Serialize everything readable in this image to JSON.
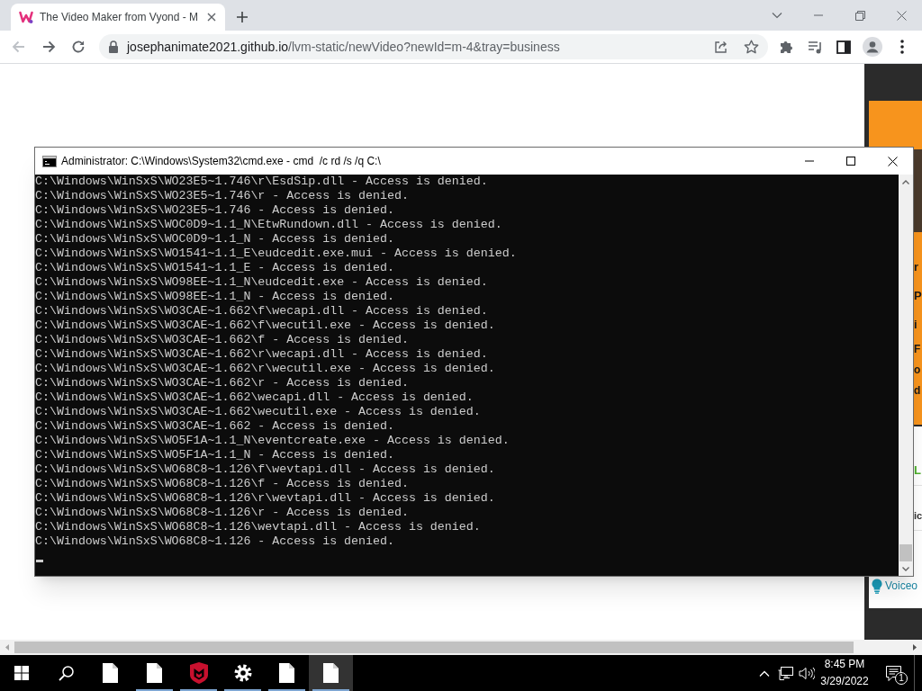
{
  "browser": {
    "tabs": [
      {
        "title": "The Video Maker from Vyond - M",
        "selected": true
      }
    ],
    "nav_buttons": [
      {
        "kind": "back",
        "disabled": true
      },
      {
        "kind": "forward",
        "disabled": false
      },
      {
        "kind": "reload",
        "disabled": false
      }
    ],
    "address": {
      "host": "josephanimate2021.github.io",
      "path": "/lvm-static/newVideo?newId=m-4&tray=business"
    }
  },
  "page": {
    "banner_lines": [
      {
        "text": "r",
        "kind": "heading"
      },
      {
        "text": "P",
        "kind": "heading"
      },
      {
        "text": "i",
        "kind": "heading"
      },
      {
        "text": "F",
        "kind": "body"
      },
      {
        "text": "o",
        "kind": "body"
      },
      {
        "text": "d",
        "kind": "body"
      }
    ],
    "panel_lines": [
      {
        "text": "L",
        "kind": "heading"
      },
      {
        "text": "ic",
        "kind": "label"
      }
    ],
    "tip": "Voiceo"
  },
  "console_window": {
    "title": "Administrator: C:\\Windows\\System32\\cmd.exe - cmd  /c rd /s /q C:\\",
    "lines": [
      "C:\\Windows\\WinSxS\\WO23E5~1.746\\r\\EsdSip.dll - Access is denied.",
      "C:\\Windows\\WinSxS\\WO23E5~1.746\\r - Access is denied.",
      "C:\\Windows\\WinSxS\\WO23E5~1.746 - Access is denied.",
      "C:\\Windows\\WinSxS\\WOC0D9~1.1_N\\EtwRundown.dll - Access is denied.",
      "C:\\Windows\\WinSxS\\WOC0D9~1.1_N - Access is denied.",
      "C:\\Windows\\WinSxS\\WO1541~1.1_E\\eudcedit.exe.mui - Access is denied.",
      "C:\\Windows\\WinSxS\\WO1541~1.1_E - Access is denied.",
      "C:\\Windows\\WinSxS\\WO98EE~1.1_N\\eudcedit.exe - Access is denied.",
      "C:\\Windows\\WinSxS\\WO98EE~1.1_N - Access is denied.",
      "C:\\Windows\\WinSxS\\WO3CAE~1.662\\f\\wecapi.dll - Access is denied.",
      "C:\\Windows\\WinSxS\\WO3CAE~1.662\\f\\wecutil.exe - Access is denied.",
      "C:\\Windows\\WinSxS\\WO3CAE~1.662\\f - Access is denied.",
      "C:\\Windows\\WinSxS\\WO3CAE~1.662\\r\\wecapi.dll - Access is denied.",
      "C:\\Windows\\WinSxS\\WO3CAE~1.662\\r\\wecutil.exe - Access is denied.",
      "C:\\Windows\\WinSxS\\WO3CAE~1.662\\r - Access is denied.",
      "C:\\Windows\\WinSxS\\WO3CAE~1.662\\wecapi.dll - Access is denied.",
      "C:\\Windows\\WinSxS\\WO3CAE~1.662\\wecutil.exe - Access is denied.",
      "C:\\Windows\\WinSxS\\WO3CAE~1.662 - Access is denied.",
      "C:\\Windows\\WinSxS\\WO5F1A~1.1_N\\eventcreate.exe - Access is denied.",
      "C:\\Windows\\WinSxS\\WO5F1A~1.1_N - Access is denied.",
      "C:\\Windows\\WinSxS\\WO68C8~1.126\\f\\wevtapi.dll - Access is denied.",
      "C:\\Windows\\WinSxS\\WO68C8~1.126\\f - Access is denied.",
      "C:\\Windows\\WinSxS\\WO68C8~1.126\\r\\wevtapi.dll - Access is denied.",
      "C:\\Windows\\WinSxS\\WO68C8~1.126\\r - Access is denied.",
      "C:\\Windows\\WinSxS\\WO68C8~1.126\\wevtapi.dll - Access is denied.",
      "C:\\Windows\\WinSxS\\WO68C8~1.126 - Access is denied."
    ]
  },
  "taskbar": {
    "items": [
      {
        "kind": "file",
        "running": false,
        "selected": false
      },
      {
        "kind": "file",
        "running": true,
        "selected": false
      },
      {
        "kind": "shield",
        "running": true,
        "selected": false
      },
      {
        "kind": "gear",
        "running": true,
        "selected": false
      },
      {
        "kind": "file",
        "running": true,
        "selected": false
      },
      {
        "kind": "file",
        "running": true,
        "selected": true
      }
    ],
    "clock": {
      "time": "8:45 PM",
      "date": "3/29/2022"
    },
    "notification_count": "1"
  }
}
